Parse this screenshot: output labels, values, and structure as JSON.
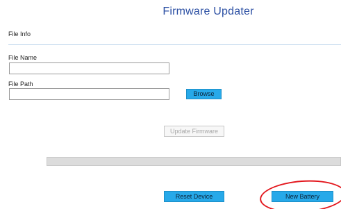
{
  "window": {
    "title": "Firmware Updater"
  },
  "file_info": {
    "section_label": "File Info",
    "file_name_label": "File Name",
    "file_name_value": "",
    "file_path_label": "File Path",
    "file_path_value": "",
    "browse_label": "Browse"
  },
  "actions": {
    "update_label": "Update Firmware",
    "reset_label": "Reset Device",
    "new_battery_label": "New Battery"
  },
  "progress": {
    "value": 0
  },
  "colors": {
    "title": "#2b4fa3",
    "accent_button": "#27a9e9",
    "annotation": "#e3161c"
  }
}
